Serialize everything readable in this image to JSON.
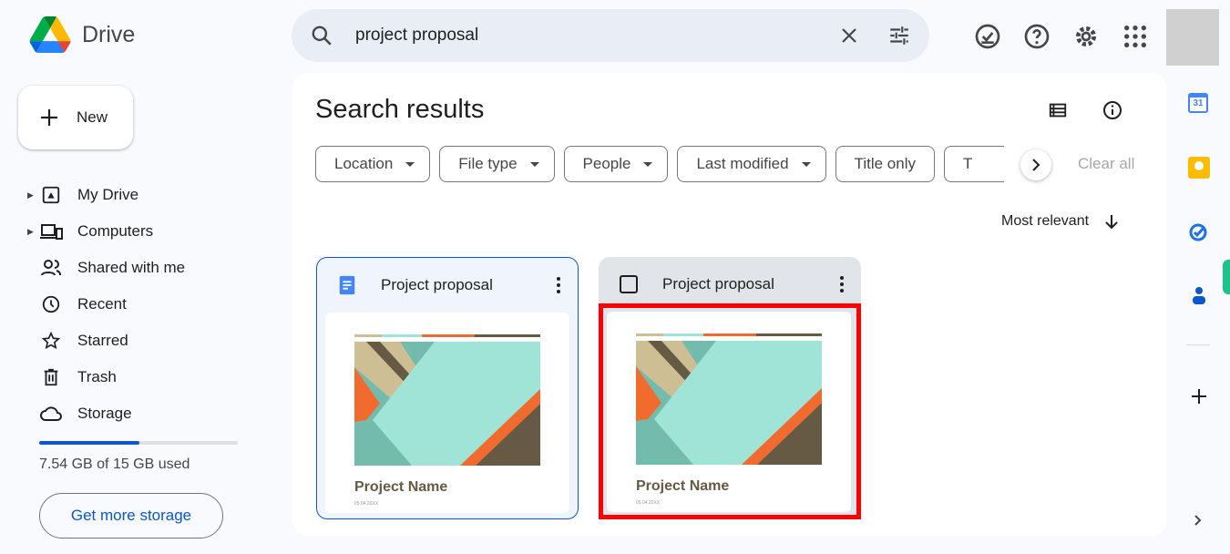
{
  "app": {
    "name": "Drive"
  },
  "search": {
    "query": "project proposal"
  },
  "sidebar": {
    "new_label": "New",
    "items": [
      {
        "label": "My Drive",
        "icon": "my-drive-icon",
        "expandable": true
      },
      {
        "label": "Computers",
        "icon": "computers-icon",
        "expandable": true
      },
      {
        "label": "Shared with me",
        "icon": "shared-icon",
        "expandable": false
      },
      {
        "label": "Recent",
        "icon": "clock-icon",
        "expandable": false
      },
      {
        "label": "Starred",
        "icon": "star-icon",
        "expandable": false
      },
      {
        "label": "Trash",
        "icon": "trash-icon",
        "expandable": false
      },
      {
        "label": "Storage",
        "icon": "cloud-icon",
        "expandable": false
      }
    ],
    "storage": {
      "used_text": "7.54 GB of 15 GB used",
      "used_fraction": 0.503,
      "button": "Get more storage"
    }
  },
  "main": {
    "title": "Search results",
    "filters": [
      "Location",
      "File type",
      "People",
      "Last modified",
      "Title only",
      "T"
    ],
    "clear_all": "Clear all",
    "sort": "Most relevant",
    "files": [
      {
        "name": "Project proposal",
        "thumb_title": "Project Name",
        "thumb_date": "05.04.20XX",
        "selected": true
      },
      {
        "name": "Project proposal",
        "thumb_title": "Project Name",
        "thumb_date": "05.04.20XX",
        "selected": false,
        "highlighted": true
      }
    ]
  },
  "colors": {
    "accent": "#0b57d0",
    "highlight": "#ff0000"
  },
  "calendar_day": "31"
}
